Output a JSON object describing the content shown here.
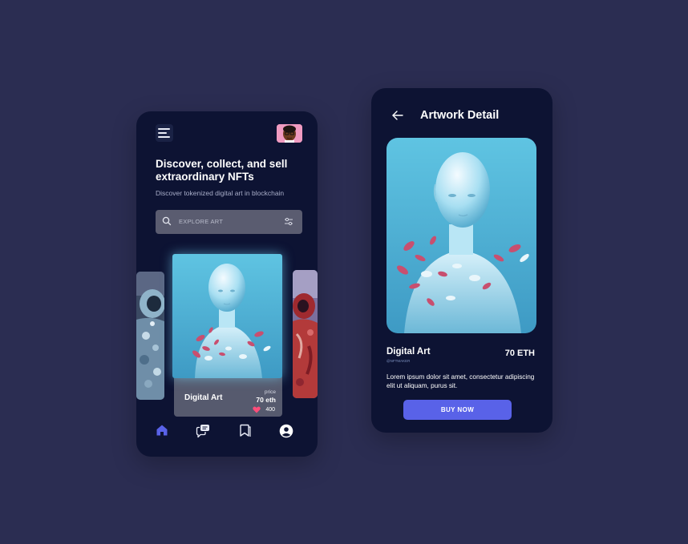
{
  "home": {
    "headline": "Discover, collect, and sell extraordinary NFTs",
    "subline": "Discover tokenized digital art in blockchain",
    "search": {
      "placeholder": "EXPLORE ART"
    },
    "featured_card": {
      "title": "Digital Art",
      "price_label": "price",
      "price": "70 eth",
      "likes": "400"
    },
    "nav": [
      "home-icon",
      "chat-icon",
      "bookmark-icon",
      "profile-icon"
    ]
  },
  "detail": {
    "title": "Artwork Detail",
    "name": "Digital Art",
    "handle": "@NFTMAKER",
    "price": "70 ETH",
    "description": "Lorem ipsum dolor sit amet, consectetur adipiscing elit ut aliquam, purus sit.",
    "buy_label": "BUY NOW"
  },
  "colors": {
    "background": "#2b2d52",
    "phone": "#0d1333",
    "accent": "#5962e8",
    "card": "#565a6e",
    "search": "#5a5c70",
    "heart": "#ff4d7a"
  }
}
